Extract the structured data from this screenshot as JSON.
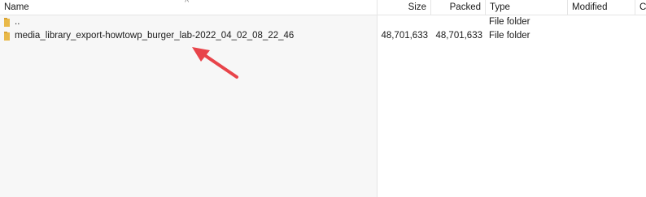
{
  "columns": {
    "name": "Name",
    "size": "Size",
    "packed": "Packed",
    "type": "Type",
    "modified": "Modified",
    "extra": "C"
  },
  "sort_indicator": "^",
  "rows": [
    {
      "name": "..",
      "size": "",
      "packed": "",
      "type": "File folder",
      "icon": "folder-icon"
    },
    {
      "name": "media_library_export-howtowp_burger_lab-2022_04_02_08_22_46",
      "size": "48,701,633",
      "packed": "48,701,633",
      "type": "File folder",
      "icon": "folder-icon"
    }
  ],
  "colors": {
    "folder": "#e9b949",
    "annotation_arrow": "#e8444a",
    "name_column_bg": "#f7f7f7"
  }
}
